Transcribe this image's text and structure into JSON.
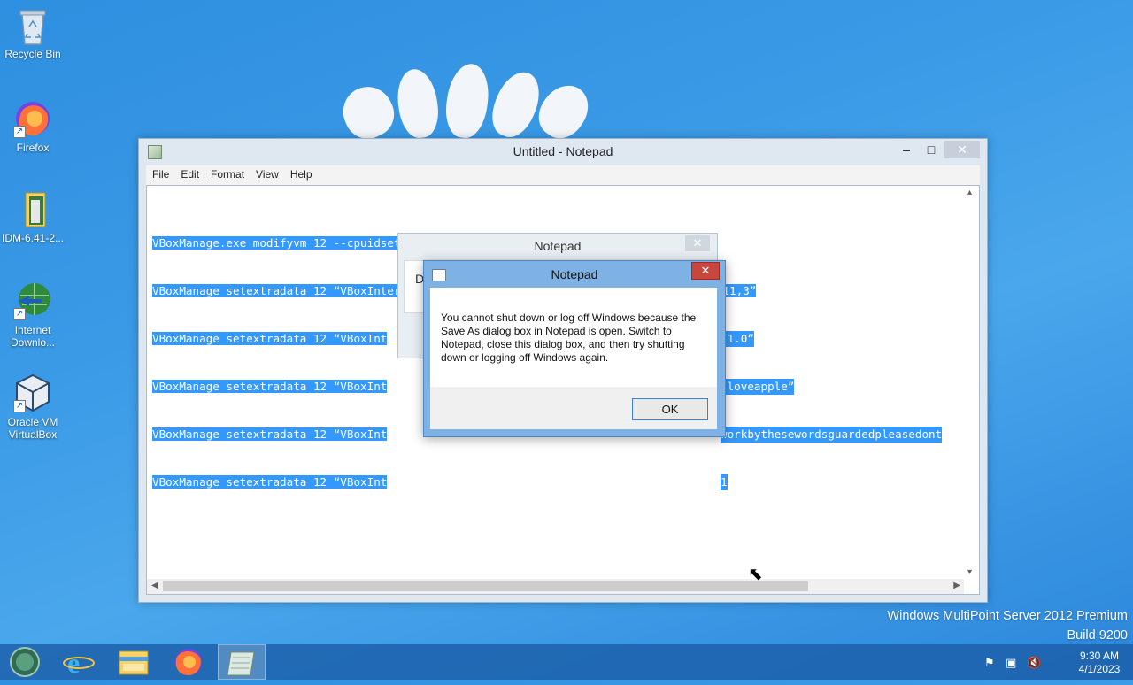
{
  "desktop": {
    "icons": [
      {
        "label": "Recycle Bin",
        "icon": "recycle-bin-icon"
      },
      {
        "label": "Firefox",
        "icon": "firefox-icon"
      },
      {
        "label": "IDM-6.41-2...",
        "icon": "folder-icon"
      },
      {
        "label": "Internet Downlo...",
        "icon": "internet-download-manager-icon"
      },
      {
        "label": "Oracle VM VirtualBox",
        "icon": "virtualbox-icon"
      }
    ],
    "watermark_line1": "Windows MultiPoint Server 2012 Premium",
    "watermark_line2": "Build 9200"
  },
  "notepad": {
    "title": "Untitled - Notepad",
    "window_controls": {
      "minimize": "–",
      "maximize": "□",
      "close": "✕"
    },
    "menu": [
      "File",
      "Edit",
      "Format",
      "View",
      "Help"
    ],
    "lines": [
      {
        "prefix": "VBoxManage.exe modifyvm 12 --cpuidset 00000001 000106e5 00100800 0098e3fd bfebfbff",
        "suffix": ""
      },
      {
        "prefix": "VBoxManage setextradata 12 “VBoxInternal/Devices/efi/0/Config/DmiSystemProduct” “iMac11,3”",
        "suffix": ""
      },
      {
        "prefix": "VBoxManage setextradata 12 “VBoxInt",
        "suffix": "“1.0”"
      },
      {
        "prefix": "VBoxManage setextradata 12 “VBoxInt",
        "suffix": "“loveapple”"
      },
      {
        "prefix": "VBoxManage setextradata 12 “VBoxInt",
        "suffix": "workbythesewordsguardedpleasedont"
      },
      {
        "prefix": "VBoxManage setextradata 12 “VBoxInt",
        "suffix": "1"
      }
    ]
  },
  "save_as_dialog": {
    "title": "Notepad",
    "close": "✕",
    "partial_text": "D"
  },
  "message_box": {
    "title": "Notepad",
    "close": "✕",
    "message": "You cannot shut down or log off Windows because the Save As dialog box in Notepad is open. Switch to Notepad, close this dialog box, and then try shutting down or logging off Windows again.",
    "ok_label": "OK"
  },
  "taskbar": {
    "items": [
      "start-orb-icon",
      "internet-explorer-icon",
      "file-explorer-icon",
      "firefox-icon",
      "notepad-icon"
    ],
    "time": "9:30 AM",
    "date": "4/1/2023"
  },
  "colors": {
    "selection": "#3399ff",
    "close_red": "#c9463d",
    "taskbar": "#1c60aa",
    "desktop": "#3a9ae6"
  }
}
